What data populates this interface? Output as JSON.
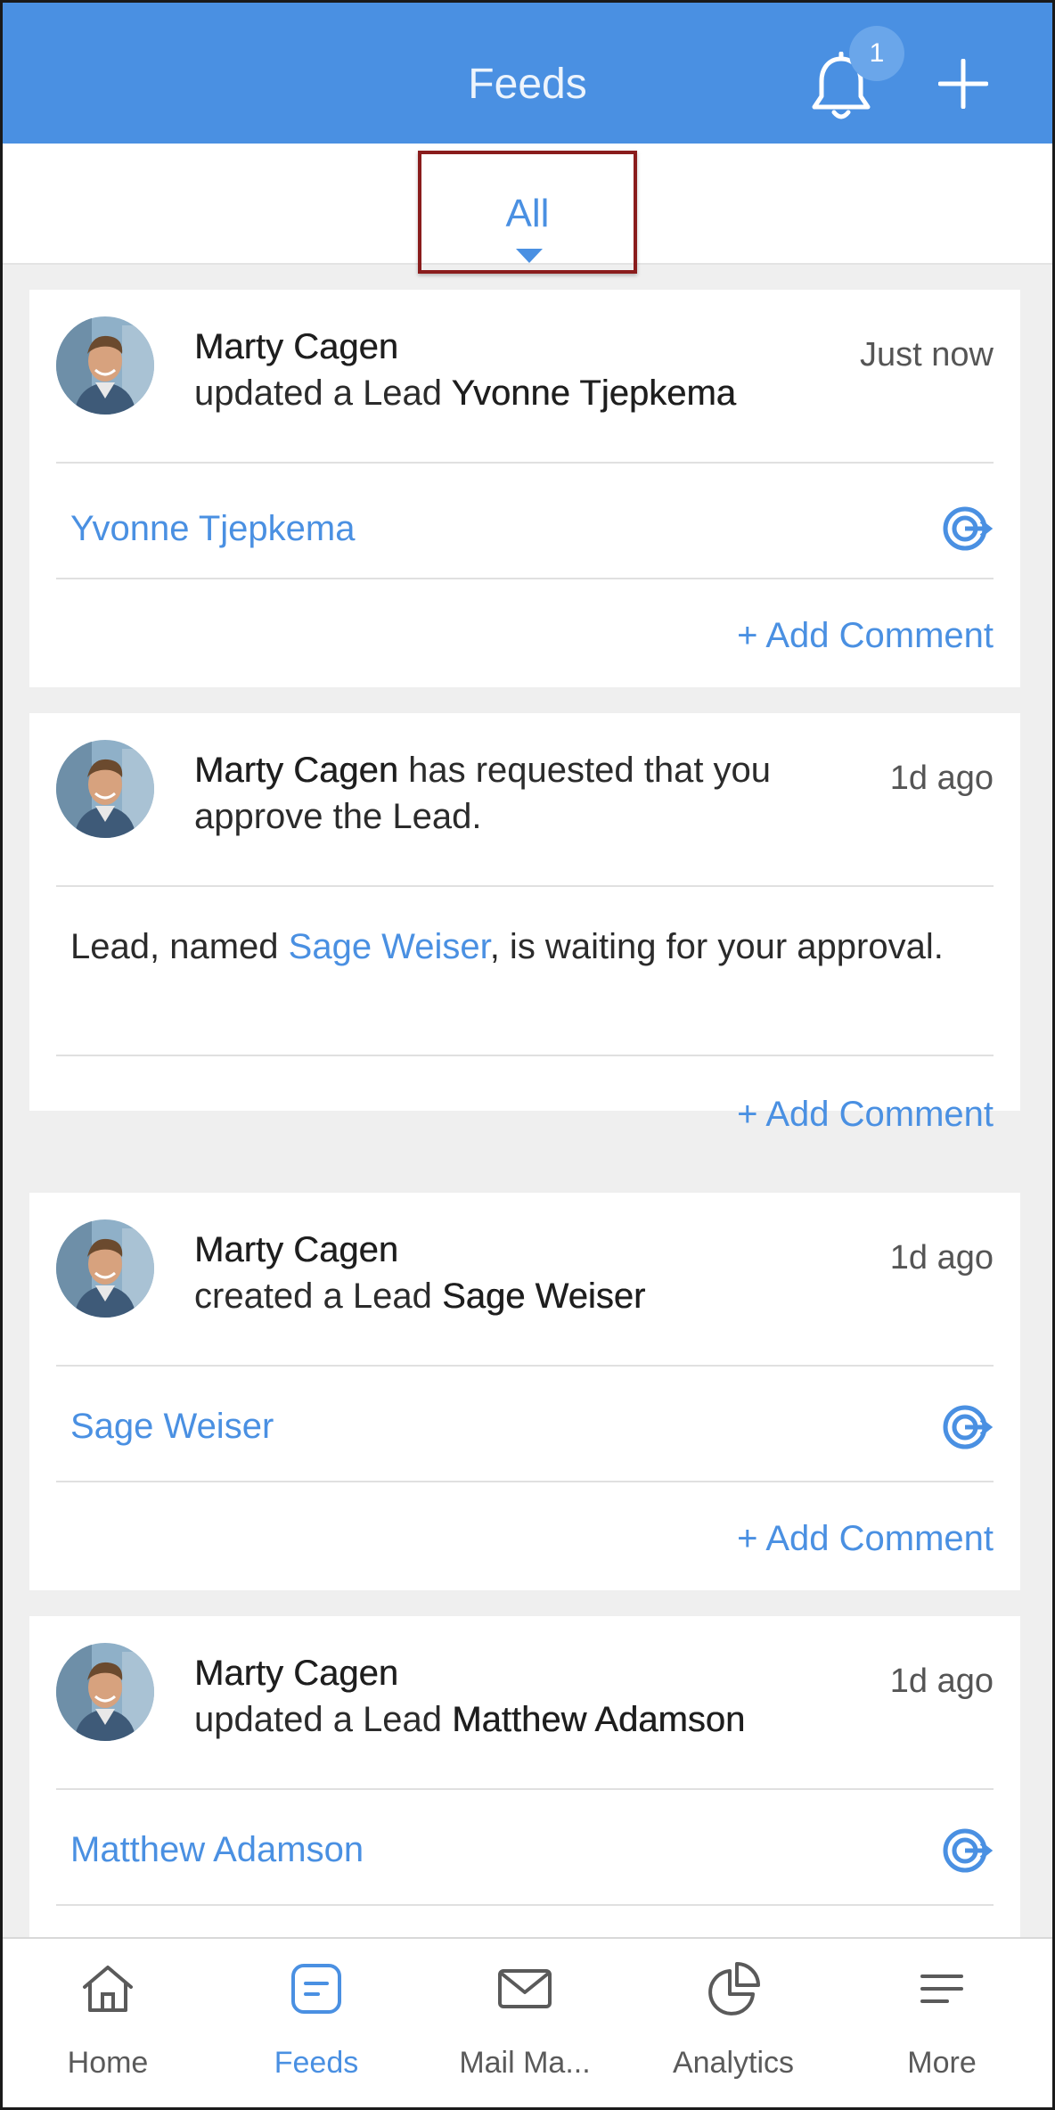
{
  "header": {
    "title": "Feeds",
    "notification_count": "1"
  },
  "filter": {
    "label": "All"
  },
  "feeds": [
    {
      "author": "Marty Cagen",
      "action": "updated  a Lead ",
      "target": "Yvonne Tjepkema",
      "time": "Just now",
      "link": "Yvonne Tjepkema",
      "add_comment": "+ Add Comment"
    },
    {
      "author": "Marty Cagen",
      "action": " has requested that you approve the Lead.",
      "time": "1d ago",
      "body_prefix": "Lead, named ",
      "body_link": "Sage Weiser",
      "body_suffix": ", is waiting for your approval.",
      "add_comment": "+ Add Comment"
    },
    {
      "author": "Marty Cagen",
      "action": "created a Lead ",
      "target": "Sage Weiser",
      "time": "1d ago",
      "link": "Sage Weiser",
      "add_comment": "+ Add Comment"
    },
    {
      "author": "Marty Cagen",
      "action": "updated  a Lead ",
      "target": "Matthew Adamson",
      "time": "1d ago",
      "link": "Matthew Adamson"
    }
  ],
  "tabbar": {
    "items": [
      {
        "label": "Home",
        "icon": "home-icon"
      },
      {
        "label": "Feeds",
        "icon": "feeds-icon",
        "active": true
      },
      {
        "label": "Mail Ma...",
        "icon": "mail-icon"
      },
      {
        "label": "Analytics",
        "icon": "analytics-icon"
      },
      {
        "label": "More",
        "icon": "menu-icon"
      }
    ]
  },
  "colors": {
    "accent": "#4a90e2",
    "highlight_box": "#8a1c1c"
  }
}
